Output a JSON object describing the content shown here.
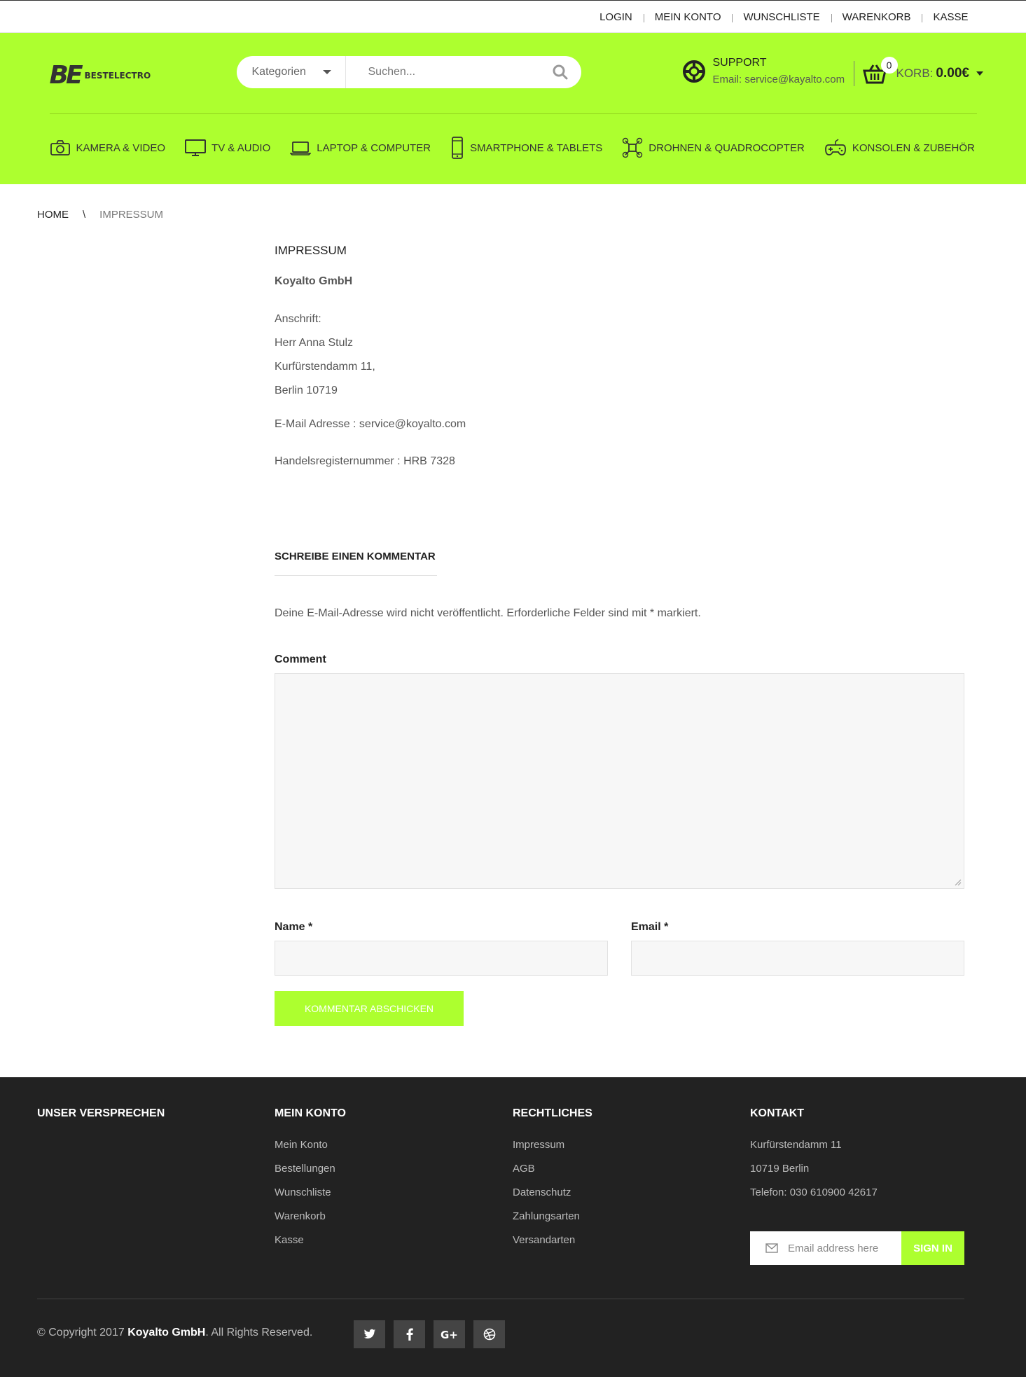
{
  "topbar": {
    "links": [
      "LOGIN",
      "MEIN KONTO",
      "WUNSCHLISTE",
      "WARENKORB",
      "KASSE"
    ]
  },
  "header": {
    "logo_mark": "BE",
    "logo_name": "BESTELECTRO",
    "search_category": "Kategorien",
    "search_placeholder": "Suchen...",
    "support_title": "SUPPORT",
    "support_email": "Email: service@kayalto.com",
    "cart_count": "0",
    "cart_label": "KORB:",
    "cart_amount": "0.00€",
    "accent_color": "#adff2f"
  },
  "categories": [
    {
      "label": "KAMERA & VIDEO",
      "icon": "camera-icon"
    },
    {
      "label": "TV & AUDIO",
      "icon": "tv-icon"
    },
    {
      "label": "LAPTOP & COMPUTER",
      "icon": "laptop-icon"
    },
    {
      "label": "SMARTPHONE & TABLETS",
      "icon": "smartphone-icon"
    },
    {
      "label": "DROHNEN & QUADROCOPTER",
      "icon": "drone-icon"
    },
    {
      "label": "KONSOLEN & ZUBEHÖR",
      "icon": "gamepad-icon"
    }
  ],
  "breadcrumb": {
    "home": "HOME",
    "separator": "\\",
    "current": "IMPRESSUM"
  },
  "content": {
    "title": "IMPRESSUM",
    "company": "Koyalto GmbH",
    "address_label": "Anschrift:",
    "address_lines": [
      "Herr Anna Stulz",
      "Kurfürstendamm 11,",
      "Berlin 10719"
    ],
    "email_line": "E-Mail Adresse : service@koyalto.com",
    "register_line": "Handelsregisternummer : HRB 7328"
  },
  "comment_form": {
    "title": "SCHREIBE EINEN KOMMENTAR",
    "notice": "Deine E-Mail-Adresse wird nicht veröffentlicht. Erforderliche Felder sind mit * markiert.",
    "comment_label": "Comment",
    "name_label": "Name *",
    "email_label": "Email *",
    "submit_label": "KOMMENTAR ABSCHICKEN"
  },
  "footer": {
    "col1_title": "UNSER VERSPRECHEN",
    "col2_title": "MEIN KONTO",
    "col2_links": [
      "Mein Konto",
      "Bestellungen",
      "Wunschliste",
      "Warenkorb",
      "Kasse"
    ],
    "col3_title": "RECHTLICHES",
    "col3_links": [
      "Impressum",
      "AGB",
      "Datenschutz",
      "Zahlungsarten",
      "Versandarten"
    ],
    "col4_title": "KONTAKT",
    "contact_lines": [
      "Kurfürstendamm 11",
      "10719 Berlin",
      "Telefon: 030 610900 42617"
    ],
    "newsletter_placeholder": "Email address here",
    "newsletter_button": "SIGN IN",
    "copyright_prefix": "© Copyright 2017 ",
    "copyright_company": "Koyalto GmbH",
    "copyright_suffix": ". All Rights Reserved.",
    "social": [
      "twitter-icon",
      "facebook-icon",
      "google-plus-icon",
      "dribbble-icon"
    ],
    "background": "#222222"
  }
}
